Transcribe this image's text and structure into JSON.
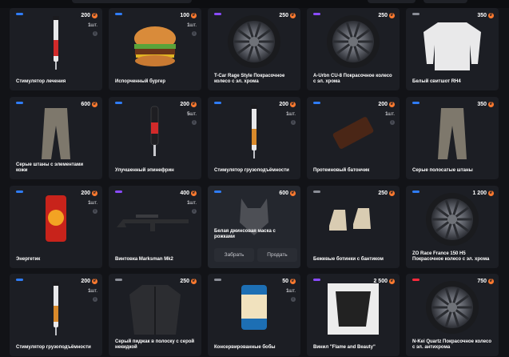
{
  "buttons": {
    "craft": "Забрать",
    "sell": "Продать"
  },
  "colors": {
    "blue": "#2f7cf6",
    "purple": "#8a4bff",
    "gray": "#8a8d96",
    "red": "#ff2a3c",
    "coin": "#ff7a2f"
  },
  "items": [
    {
      "name": "Стимулятор лечения",
      "price": "200",
      "qty_num": "1",
      "qty_unit": "шт.",
      "tag": "blue",
      "icon": "syringe-icon"
    },
    {
      "name": "Испорченный бургер",
      "price": "100",
      "qty_num": "1",
      "qty_unit": "шт.",
      "tag": "blue",
      "icon": "burger-icon"
    },
    {
      "name": "T-Car Rage Style Покрасочное колесо с эл. хрома",
      "price": "250",
      "qty_num": "",
      "qty_unit": "",
      "tag": "purple",
      "icon": "wheel-icon"
    },
    {
      "name": "A-Urbn CU-8 Покрасочное колесо с эл. хрома",
      "price": "250",
      "qty_num": "",
      "qty_unit": "",
      "tag": "purple",
      "icon": "wheel-icon"
    },
    {
      "name": "Белый свитшот RH4",
      "price": "350",
      "qty_num": "",
      "qty_unit": "",
      "tag": "gray",
      "icon": "sweatshirt-icon"
    },
    {
      "name": "Серые штаны с элементами кожи",
      "price": "600",
      "qty_num": "",
      "qty_unit": "",
      "tag": "blue",
      "icon": "pants-icon"
    },
    {
      "name": "Улучшенный эпинефрин",
      "price": "200",
      "qty_num": "5",
      "qty_unit": "шт.",
      "tag": "blue",
      "icon": "injector-icon"
    },
    {
      "name": "Стимулятор грузоподъёмности",
      "price": "200",
      "qty_num": "1",
      "qty_unit": "шт.",
      "tag": "blue",
      "icon": "syringe-icon"
    },
    {
      "name": "Протеиновый батончик",
      "price": "200",
      "qty_num": "1",
      "qty_unit": "шт.",
      "tag": "blue",
      "icon": "protein-bar-icon"
    },
    {
      "name": "Серые полосатые штаны",
      "price": "350",
      "qty_num": "",
      "qty_unit": "",
      "tag": "blue",
      "icon": "pants-icon"
    },
    {
      "name": "Энергетик",
      "price": "200",
      "qty_num": "1",
      "qty_unit": "шт.",
      "tag": "blue",
      "icon": "energy-can-icon"
    },
    {
      "name": "Винтовка Marksman Mk2",
      "price": "400",
      "qty_num": "1",
      "qty_unit": "шт.",
      "tag": "purple",
      "icon": "rifle-icon"
    },
    {
      "name": "Белая джинсовая маска с рожками",
      "price": "600",
      "qty_num": "",
      "qty_unit": "",
      "tag": "blue",
      "icon": "mask-icon",
      "buttons": true
    },
    {
      "name": "Бежевые ботинки с бантиком",
      "price": "250",
      "qty_num": "",
      "qty_unit": "",
      "tag": "gray",
      "icon": "boots-icon"
    },
    {
      "name": "ZO Race France 150 H5 Покрасочное колесо с эл. хрома",
      "price": "1 200",
      "qty_num": "",
      "qty_unit": "",
      "tag": "blue",
      "icon": "wheel-icon"
    },
    {
      "name": "Стимулятор грузоподъёмности",
      "price": "200",
      "qty_num": "1",
      "qty_unit": "шт.",
      "tag": "blue",
      "icon": "syringe-icon"
    },
    {
      "name": "Серый пиджак в полоску с серой некидкой",
      "price": "250",
      "qty_num": "",
      "qty_unit": "",
      "tag": "gray",
      "icon": "jacket-icon"
    },
    {
      "name": "Консервированные бобы",
      "price": "50",
      "qty_num": "1",
      "qty_unit": "шт.",
      "tag": "gray",
      "icon": "beans-can-icon"
    },
    {
      "name": "Винил \"Flame and Beauty\"",
      "price": "2 500",
      "qty_num": "",
      "qty_unit": "",
      "tag": "purple",
      "icon": "vinyl-icon"
    },
    {
      "name": "N-Kei Quartz Покрасочное колесо с эл. антихрома",
      "price": "750",
      "qty_num": "",
      "qty_unit": "",
      "tag": "red",
      "icon": "wheel-icon"
    }
  ]
}
